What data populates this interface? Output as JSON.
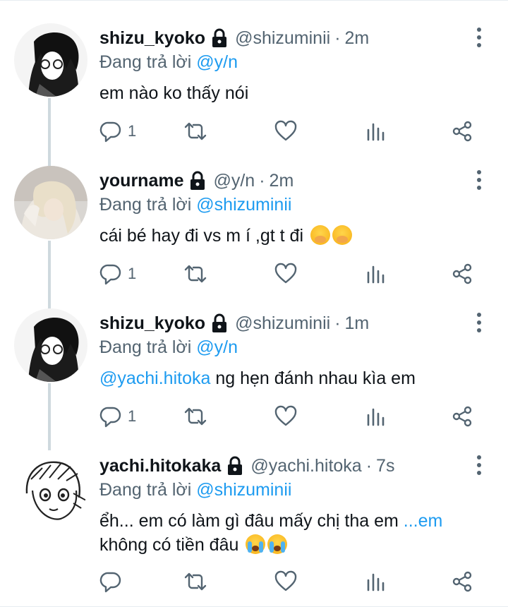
{
  "reply_prefix": "Đang trả lời",
  "tweets": [
    {
      "name": "shizu_kyoko",
      "handle": "@shizuminii",
      "dot": "·",
      "time": "2m",
      "reply_to": "@y/n",
      "text": "em nào ko thấy nói",
      "mention": "",
      "replies": "1",
      "avatar": "manga-girl-dark-hair"
    },
    {
      "name": "yourname",
      "handle": "@y/n",
      "dot": "·",
      "time": "2m",
      "reply_to": "@shizuminii",
      "text": "cái bé hay đi vs m í ,gt t đi",
      "mention": "",
      "replies": "1",
      "avatar": "blonde-photo",
      "emoji": [
        "face-with-hand-over-mouth",
        "face-with-hand-over-mouth"
      ]
    },
    {
      "name": "shizu_kyoko",
      "handle": "@shizuminii",
      "dot": "·",
      "time": "1m",
      "reply_to": "@y/n",
      "mention": "@yachi.hitoka",
      "text": " ng hẹn đánh nhau kìa em",
      "replies": "1",
      "avatar": "manga-girl-dark-hair"
    },
    {
      "name": "yachi.hitokaka",
      "handle": "@yachi.hitoka",
      "dot": "·",
      "time": "7s",
      "reply_to": "@shizuminii",
      "text": "ểh... em có làm gì đâu mấy chị tha em ",
      "more_link": "...em",
      "text2": "không có tiền đâu",
      "replies": "",
      "avatar": "manga-girl-light-hair",
      "emoji": [
        "loudly-crying-face",
        "loudly-crying-face"
      ]
    }
  ],
  "icons": {
    "reply": "reply-icon",
    "retweet": "retweet-icon",
    "like": "heart-icon",
    "stats": "analytics-icon",
    "share": "share-icon",
    "lock": "lock-icon",
    "more": "more-vertical-icon"
  },
  "colors": {
    "link": "#1d9bf0",
    "secondary": "#536471",
    "thread_line": "#cfd9de"
  }
}
